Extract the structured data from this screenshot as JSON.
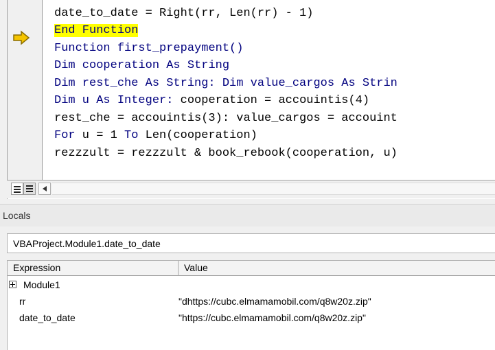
{
  "code_window": {
    "lines": [
      {
        "parts": [
          {
            "t": "date_to_date = Right(rr, Len(rr) - 1)",
            "kind": "plain"
          }
        ]
      },
      {
        "parts": [
          {
            "t": "End Function",
            "kind": "keyword-highlight"
          }
        ]
      },
      {
        "parts": [
          {
            "t": "Function",
            "kind": "kw"
          },
          {
            "t": " first_prepayment()",
            "kind": "kw"
          }
        ]
      },
      {
        "parts": [
          {
            "t": "Dim",
            "kind": "kw"
          },
          {
            "t": " cooperation ",
            "kind": "kw"
          },
          {
            "t": "As",
            "kind": "kw"
          },
          {
            "t": " String",
            "kind": "kw"
          }
        ]
      },
      {
        "parts": [
          {
            "t": "Dim rest_che As String: Dim value_cargos As Strin",
            "kind": "kw"
          }
        ]
      },
      {
        "parts": [
          {
            "t": "Dim u As Integer:",
            "kind": "kw"
          },
          {
            "t": " cooperation = accouintis(4)",
            "kind": "plain"
          }
        ]
      },
      {
        "parts": [
          {
            "t": "rest_che = accouintis(3): value_cargos = accouint",
            "kind": "plain"
          }
        ]
      },
      {
        "parts": [
          {
            "t": "For",
            "kind": "kw"
          },
          {
            "t": " u = 1 ",
            "kind": "plain"
          },
          {
            "t": "To",
            "kind": "kw"
          },
          {
            "t": " Len(cooperation)",
            "kind": "plain"
          }
        ]
      },
      {
        "parts": [
          {
            "t": "rezzzult = rezzzult & book_rebook(cooperation, u)",
            "kind": "plain"
          }
        ]
      }
    ],
    "execution_pointer_icon": "yellow-arrow-icon"
  },
  "locals": {
    "title": "Locals",
    "context": "VBAProject.Module1.date_to_date",
    "columns": {
      "expression": "Expression",
      "value": "Value"
    },
    "rows": [
      {
        "expression": "Module1",
        "value": "",
        "expandable": true
      },
      {
        "expression": "rr",
        "value": "\"dhttps://cubc.elmamamobil.com/q8w20z.zip\""
      },
      {
        "expression": "date_to_date",
        "value": "\"https://cubc.elmamamobil.com/q8w20z.zip\""
      }
    ]
  },
  "colors": {
    "keyword": "#00007f",
    "highlight": "#ffff00",
    "arrow": "#f5c400"
  }
}
